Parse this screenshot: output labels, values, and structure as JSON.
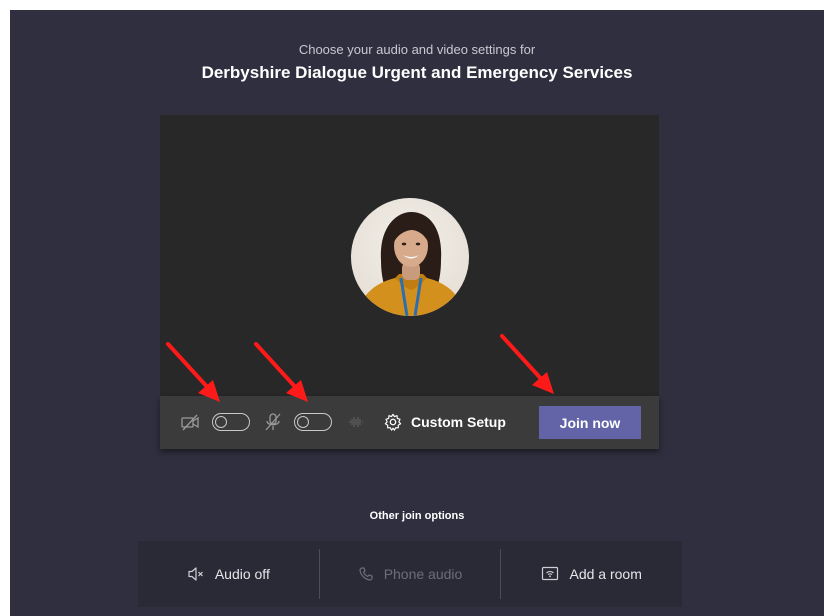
{
  "header": {
    "subtitle": "Choose your audio and video settings for",
    "meeting_title": "Derbyshire Dialogue Urgent and Emergency Services"
  },
  "controls": {
    "camera_toggle_on": false,
    "mic_toggle_on": false,
    "custom_setup_label": "Custom Setup",
    "join_label": "Join now"
  },
  "other_options": {
    "label": "Other join options",
    "items": [
      {
        "label": "Audio off",
        "icon": "speaker-off-icon",
        "enabled": true
      },
      {
        "label": "Phone audio",
        "icon": "phone-icon",
        "enabled": false
      },
      {
        "label": "Add a room",
        "icon": "room-cast-icon",
        "enabled": true
      }
    ]
  },
  "colors": {
    "background": "#2f2f3f",
    "accent": "#6264a7",
    "annotation_arrows": "#ff1a1a"
  }
}
